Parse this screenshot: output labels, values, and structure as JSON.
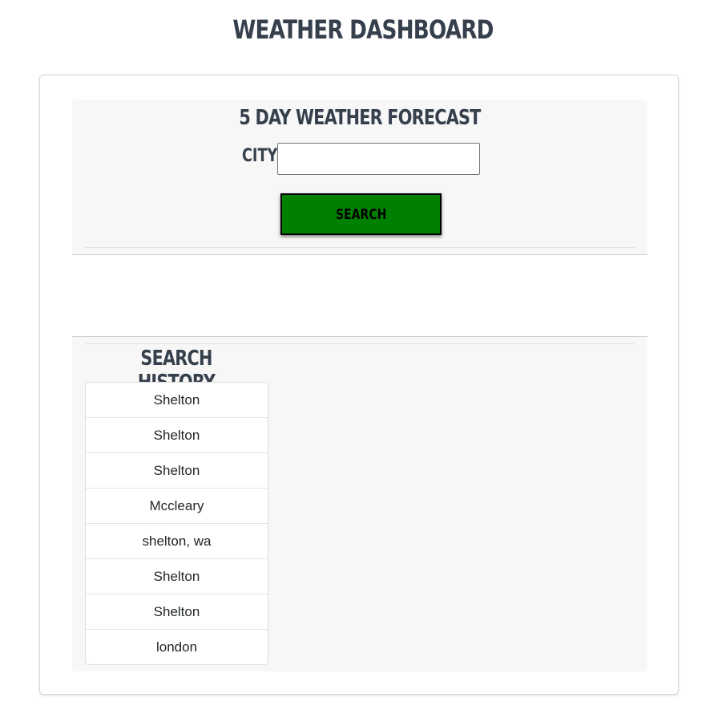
{
  "header": {
    "title": "WEATHER DASHBOARD"
  },
  "forecast_panel": {
    "heading": "5 DAY WEATHER FORECAST",
    "city_label": "CITY:",
    "city_input_value": "",
    "search_label": "SEARCH"
  },
  "history": {
    "heading": "SEARCH HISTORY",
    "items": [
      "Shelton",
      "Shelton",
      "Shelton",
      "Mccleary",
      "shelton, wa",
      "Shelton",
      "Shelton",
      "london"
    ]
  },
  "colors": {
    "heading_text": "#36404d",
    "search_button_bg": "#008000",
    "panel_bg": "#f7f7f7"
  }
}
